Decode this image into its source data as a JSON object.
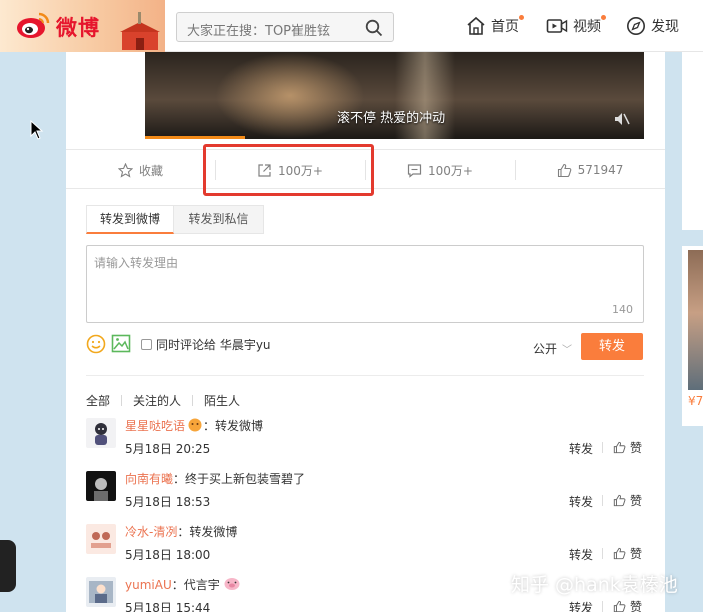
{
  "header": {
    "brand": "微博",
    "search": {
      "placeholder": "大家正在搜：TOP崔胜铉"
    },
    "nav": [
      {
        "label": "首页",
        "icon": "home-icon",
        "badge": true
      },
      {
        "label": "视频",
        "icon": "video-icon",
        "badge": true
      },
      {
        "label": "发现",
        "icon": "compass-icon",
        "badge": false
      }
    ]
  },
  "video": {
    "subtitle": "滚不停  热爱的冲动",
    "progress": 0.2
  },
  "actions": {
    "favorite": "收藏",
    "forward_count": "100万+",
    "comment_count": "100万+",
    "like_count": "571947"
  },
  "forward": {
    "tabs": [
      "转发到微博",
      "转发到私信"
    ],
    "placeholder": "请输入转发理由",
    "char_count": "140",
    "also_comment_label": "同时评论给 华晨宇yu",
    "visibility": "公开",
    "submit": "转发"
  },
  "filters": [
    "全部",
    "关注的人",
    "陌生人"
  ],
  "reposts": [
    {
      "user": "星星哒吃语",
      "text": "：转发微博",
      "time": "5月18日 20:25",
      "retweet": "转发",
      "like": "赞"
    },
    {
      "user": "向南有曦",
      "text": "：终于买上新包装雪碧了",
      "time": "5月18日 18:53",
      "retweet": "转发",
      "like": "赞"
    },
    {
      "user": "冷水-清冽",
      "text": "：转发微博",
      "time": "5月18日 18:00",
      "retweet": "转发",
      "like": "赞"
    },
    {
      "user": "yumiAU",
      "text": "：代言宇",
      "time": "5月18日 15:44",
      "retweet": "转发",
      "like": "赞"
    }
  ],
  "side": {
    "right_card_text": "¥7"
  },
  "watermark": "知乎 @hank袁榛池",
  "colors": {
    "accent": "#fa7d3c",
    "brand_red": "#e6162d",
    "username": "#eb7350",
    "highlight_box": "#e33a2e"
  }
}
